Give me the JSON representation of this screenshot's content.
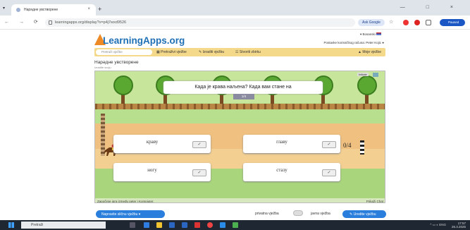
{
  "browser": {
    "tab_title": "Нарәдне увстворене",
    "tab_close": "×",
    "new_tab": "+",
    "url": "learningapps.org/display?v=p4j7wxd9526",
    "ask_google": "Ask Google",
    "profile_label": "Paused",
    "window_controls": "— □ ×"
  },
  "site": {
    "logo_text": "LearningApps.org",
    "language": "Bosanski",
    "account_text": "Postavke korisničkog računa: Peter Kojic",
    "search_placeholder": "Pretraži vježbe",
    "menu": [
      "Pretraživi vježbe",
      "Izraditi vježbu",
      "Stvoriti zbirku"
    ],
    "my_tasks": "Moje vježbe"
  },
  "app": {
    "title": "Нарәдне увстворене",
    "subtitle": "Izradite svoju"
  },
  "game": {
    "fullscreen": "Initiate",
    "question": "Када је крава наљена? Када вам стане на",
    "progress": "1/4",
    "score": "0/4",
    "cards": [
      {
        "word": "краву",
        "ok": "✓"
      },
      {
        "word": "главу",
        "ok": "✓"
      },
      {
        "word": "ногу",
        "ok": "✓"
      },
      {
        "word": "стазу",
        "ok": "✓"
      }
    ],
    "footer_left": "Započinje igra između peter i Kompjuter.",
    "footer_right": "Prikaži Chat"
  },
  "bottom": {
    "make_button": "Napravite sličnu vježbu",
    "private_label": "privatna vježba",
    "public_label": "javna vježba",
    "edit_button": "Uredite vježbu"
  },
  "taskbar": {
    "search": "Pretraži",
    "time": "17:57",
    "date": "26.3.2025",
    "lang": "ENG"
  }
}
